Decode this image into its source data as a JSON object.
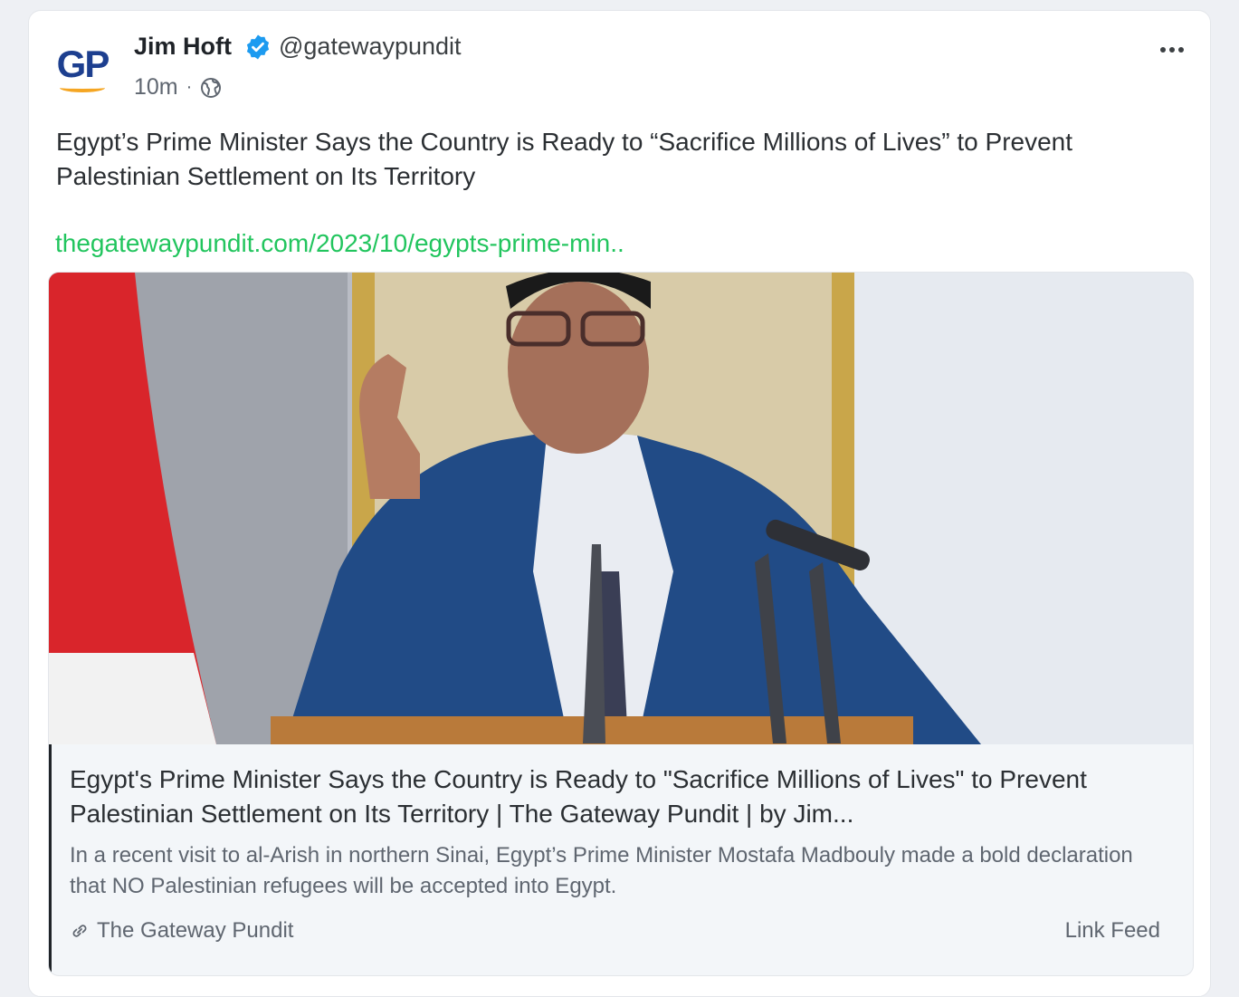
{
  "post": {
    "author_name": "Jim Hoft",
    "handle": "@gatewaypundit",
    "avatar_text": "GP",
    "time": "10m",
    "separator": "·",
    "text": "Egypt’s Prime Minister Says the Country is Ready to “Sacrifice Millions of Lives” to Prevent Palestinian Settlement on Its Territory",
    "link": "thegatewaypundit.com/2023/10/egypts-prime-min..",
    "icons": [
      "verified-badge-icon",
      "globe-icon",
      "more-options-icon"
    ]
  },
  "preview": {
    "title": "Egypt's Prime Minister Says the Country is Ready to \"Sacrifice Millions of Lives\" to Prevent Palestinian Settlement on Its Territory | The Gateway Pundit | by Jim...",
    "description": "In a recent visit to al-Arish in northern Sinai, Egypt’s Prime Minister Mostafa Madbouly made a bold declaration that NO Palestinian refugees will be accepted into Egypt.",
    "source": "The Gateway Pundit",
    "feed_label": "Link Feed",
    "icons": [
      "link-icon"
    ]
  },
  "colors": {
    "link": "#22c55e",
    "verified": "#1d9bf0",
    "avatar_text": "#1d3f8f",
    "avatar_accent": "#f5a623"
  }
}
